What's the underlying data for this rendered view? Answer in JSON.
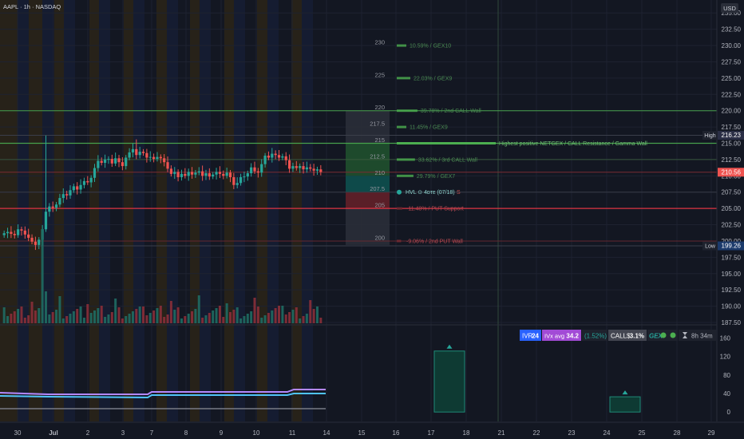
{
  "header": {
    "title": "AAPL · 1h · NASDAQ",
    "currency": "USD"
  },
  "colors": {
    "background": "#131722",
    "up": "#26a69a",
    "down": "#ef5350",
    "green_line": "#4caf50",
    "red_line": "#f23645",
    "band_orange": "#2a2418",
    "band_blue": "#151c33",
    "gex_panel_bg": "#1a1d28"
  },
  "price_axis": {
    "labels": [
      "235.00",
      "232.50",
      "230.00",
      "227.50",
      "225.00",
      "222.50",
      "220.00",
      "217.50",
      "215.00",
      "212.50",
      "210.00",
      "207.50",
      "205.00",
      "202.50",
      "200.00",
      "197.50",
      "195.00",
      "192.50",
      "190.00",
      "187.50"
    ],
    "high_label": "High",
    "high_value": "216.23",
    "low_label": "Low",
    "low_value": "199.26",
    "current_price": "210.56"
  },
  "indicator_axis": {
    "labels": [
      "160",
      "120",
      "80",
      "40",
      "0"
    ]
  },
  "time_axis": {
    "labels": [
      "30",
      "Jul",
      "2",
      "3",
      "7",
      "8",
      "9",
      "10",
      "11",
      "14",
      "15",
      "16",
      "17",
      "18",
      "21",
      "22",
      "23",
      "24",
      "25",
      "28",
      "29"
    ]
  },
  "gex_levels": {
    "strikes": [
      "230",
      "225",
      "220",
      "217.5",
      "215",
      "212.5",
      "210",
      "207.5",
      "205",
      "200"
    ],
    "labels": [
      "10.59% / GEX10",
      "22.03% / GEX9",
      "39.78% / 2nd CALL Wall",
      "11.45% / GEX9",
      "Highest positive NETGEX / CALL Resistance / Gamma Wall",
      "33.62% / 3rd CALL Wall",
      "29.79% / GEX7",
      "HVL ⊙ 4ᴅᴛᴇ (07/18)",
      "-11.48% / PUT Support",
      "-9.06% / 2nd PUT Wall"
    ]
  },
  "status_bar": {
    "ivr_label": "IVR",
    "ivr_value": "24",
    "ivx_label": "IVx avg",
    "ivx_value": "34.2",
    "ivx_change": "(1.52%)",
    "calls_label": "CALL$",
    "calls_value": "3.1%",
    "gex_label": "GEX",
    "timer": "8h 34m"
  },
  "chart_data": {
    "type": "candlestick",
    "title": "AAPL · 1h · NASDAQ",
    "ylim": [
      187.5,
      236.5
    ],
    "y_ticks": [
      235,
      232.5,
      230,
      227.5,
      225,
      222.5,
      220,
      217.5,
      215,
      212.5,
      210,
      207.5,
      205,
      202.5,
      200,
      197.5,
      195,
      192.5,
      190,
      187.5
    ],
    "x_categories": [
      "30",
      "Jul",
      "2",
      "3",
      "7",
      "8",
      "9",
      "10",
      "11",
      "14"
    ],
    "close_series": [
      201.2,
      201.4,
      201.1,
      200.9,
      201.8,
      201.6,
      201.0,
      200.5,
      199.9,
      199.4,
      200.2,
      201.8,
      204.5,
      205.3,
      205.1,
      205.6,
      206.6,
      207.2,
      207.0,
      207.8,
      208.4,
      207.9,
      208.6,
      209.2,
      209.0,
      209.7,
      211.2,
      212.3,
      212.0,
      212.5,
      212.6,
      211.9,
      212.7,
      212.1,
      211.5,
      212.8,
      213.6,
      214.1,
      213.2,
      213.7,
      213.5,
      212.8,
      212.9,
      212.6,
      212.9,
      212.7,
      212.1,
      211.1,
      210.3,
      210.6,
      209.8,
      210.3,
      210.0,
      210.6,
      210.2,
      210.5,
      210.7,
      210.0,
      210.4,
      209.9,
      210.2,
      210.6,
      210.3,
      210.0,
      210.5,
      209.8,
      208.6,
      208.9,
      209.8,
      209.9,
      210.4,
      211.3,
      210.7,
      210.5,
      211.8,
      213.1,
      212.8,
      213.4,
      213.2,
      212.8,
      213.0,
      212.4,
      211.1,
      211.5,
      211.2,
      211.5,
      211.0,
      211.3,
      211.1,
      210.8,
      211.0,
      210.6
    ],
    "ohlc_sample": [
      {
        "time": "Jul",
        "open": 205.3,
        "high": 216.2,
        "low": 205.0,
        "close": 205.1
      },
      {
        "time": "7",
        "open": 213.2,
        "high": 215.6,
        "low": 212.5,
        "close": 213.7
      },
      {
        "time": "10",
        "open": 212.2,
        "high": 213.7,
        "low": 211.6,
        "close": 213.1
      }
    ],
    "high": 216.23,
    "low": 199.26,
    "last": 210.56,
    "gex_levels": [
      {
        "strike": 230,
        "label": "10.59% / GEX10",
        "type": "call",
        "pct": 10.59
      },
      {
        "strike": 225,
        "label": "22.03% / GEX9",
        "type": "call",
        "pct": 22.03
      },
      {
        "strike": 220,
        "label": "39.78% / 2nd CALL Wall",
        "type": "call",
        "pct": 39.78
      },
      {
        "strike": 217.5,
        "label": "11.45% / GEX9",
        "type": "call",
        "pct": 11.45
      },
      {
        "strike": 215,
        "label": "Highest positive NETGEX / CALL Resistance / Gamma Wall",
        "type": "call",
        "pct": 100
      },
      {
        "strike": 212.5,
        "label": "33.62% / 3rd CALL Wall",
        "type": "call",
        "pct": 33.62
      },
      {
        "strike": 210,
        "label": "29.79% / GEX7",
        "type": "call",
        "pct": 29.79
      },
      {
        "strike": 207.5,
        "label": "HVL ⊙ 4ᴅᴛᴇ (07/18)",
        "type": "hvl",
        "pct": 0
      },
      {
        "strike": 205,
        "label": "-11.48% / PUT Support",
        "type": "put",
        "pct": -11.48
      },
      {
        "strike": 200,
        "label": "-9.06% / 2nd PUT Wall",
        "type": "put",
        "pct": -9.06
      }
    ],
    "indicator": {
      "ylim": [
        -10,
        180
      ],
      "ticks": [
        160,
        120,
        80,
        40,
        0
      ],
      "bars": [
        {
          "x": "18",
          "value": 132
        },
        {
          "x": "25",
          "value": 33
        }
      ]
    }
  }
}
